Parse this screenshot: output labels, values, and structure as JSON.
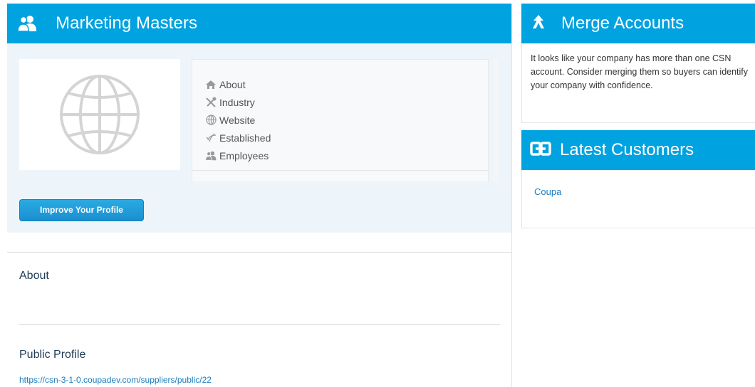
{
  "profile": {
    "company_name": "Marketing Masters",
    "info_items": [
      {
        "icon": "home-icon",
        "label": "About"
      },
      {
        "icon": "tools-icon",
        "label": "Industry"
      },
      {
        "icon": "globe-icon",
        "label": "Website"
      },
      {
        "icon": "established-icon",
        "label": "Established"
      },
      {
        "icon": "users-icon",
        "label": "Employees"
      }
    ],
    "improve_button": "Improve Your Profile"
  },
  "sections": {
    "about_title": "About",
    "public_profile_title": "Public Profile",
    "public_profile_url": "https://csn-3-1-0.coupadev.com/suppliers/public/22"
  },
  "merge": {
    "title": "Merge Accounts",
    "body": "It looks like your company has more than one CSN account. Consider merging them so buyers can identify your company with confidence."
  },
  "customers": {
    "title": "Latest Customers",
    "items": [
      "Coupa"
    ]
  },
  "colors": {
    "header_blue": "#00a2e0",
    "band_bg": "#eef5fa",
    "link_blue": "#1b7bbf"
  }
}
